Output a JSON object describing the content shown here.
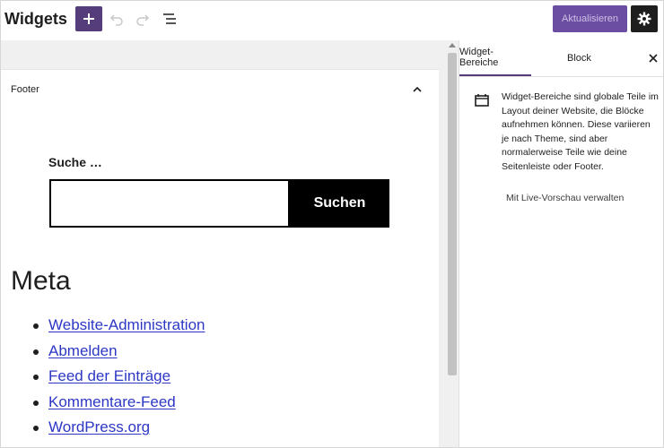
{
  "header": {
    "title": "Widgets",
    "update_label": "Aktualisieren"
  },
  "footer_area": {
    "label": "Footer",
    "search": {
      "label": "Suche …",
      "button_label": "Suchen",
      "value": ""
    },
    "meta": {
      "heading": "Meta",
      "links": [
        "Website-Administration",
        "Abmelden",
        "Feed der Einträge",
        "Kommentare-Feed",
        "WordPress.org"
      ]
    }
  },
  "sidebar": {
    "tabs": [
      "Widget-Bereiche",
      "Block"
    ],
    "active_tab": "Widget-Bereiche",
    "description": "Widget-Bereiche sind globale Teile im Layout deiner Website, die Blöcke aufnehmen können. Diese variieren je nach Theme, sind aber normalerweise Teile wie deine Seitenleiste oder Footer.",
    "live_preview_label": "Mit Live-Vorschau verwalten"
  },
  "icons": {
    "add": "plus-icon",
    "undo": "undo-icon",
    "redo": "redo-icon",
    "list_view": "list-view-icon",
    "settings": "gear-icon",
    "collapse": "chevron-up-icon",
    "close": "close-icon",
    "widget_areas": "widget-areas-icon"
  },
  "colors": {
    "accent": "#553d7b",
    "update_button": "#6b4ea1",
    "link": "#2d37c4"
  }
}
